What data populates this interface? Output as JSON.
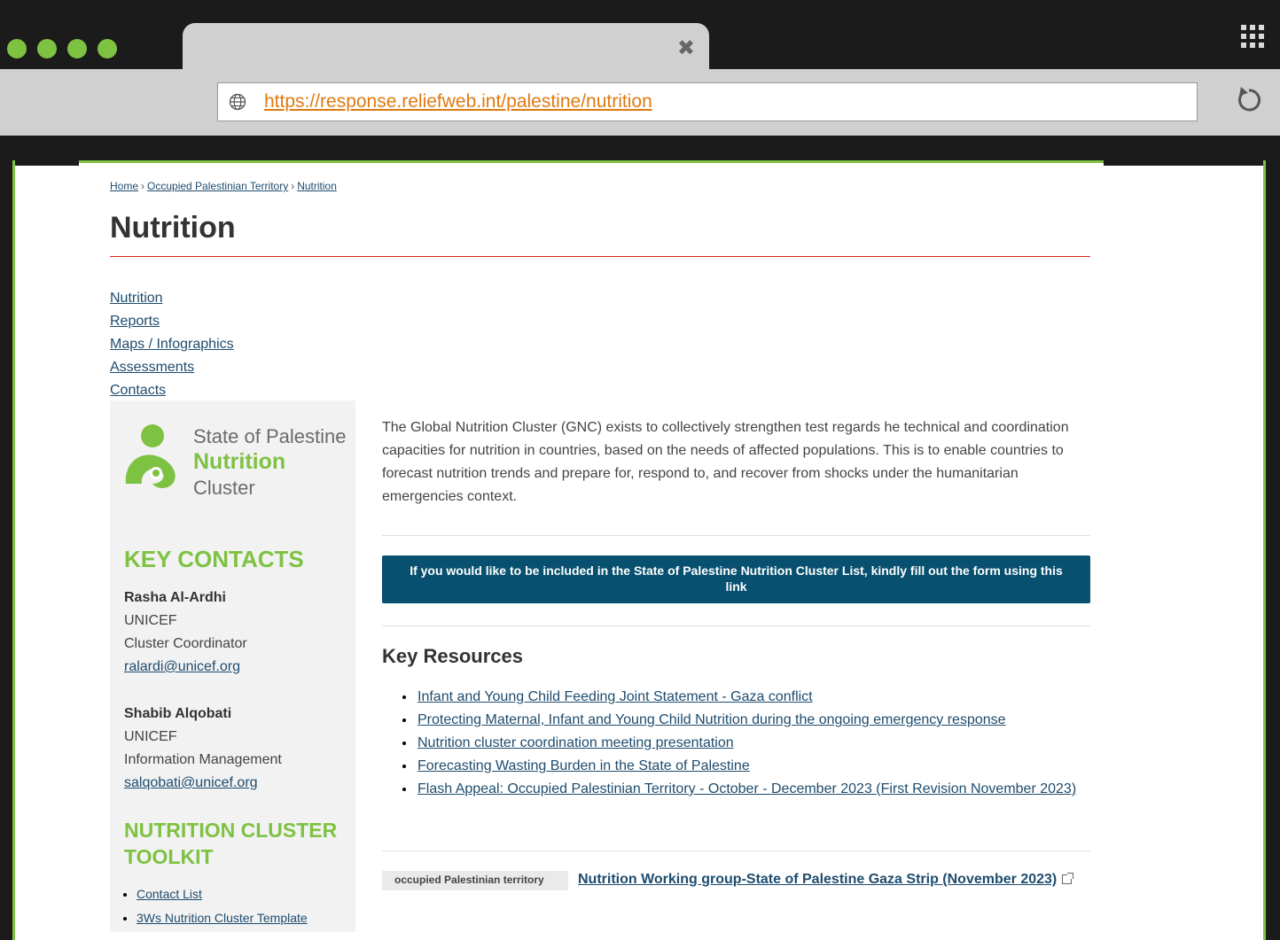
{
  "browser": {
    "tab_close": "✖",
    "url": "https://response.reliefweb.int/palestine/nutrition"
  },
  "breadcrumb": [
    "Home",
    "Occupied Palestinian Territory",
    "Nutrition"
  ],
  "breadcrumb_sep": "›",
  "page_title": "Nutrition",
  "subnav": [
    "Nutrition",
    "Reports",
    "Maps / Infographics",
    "Assessments",
    "Contacts"
  ],
  "logo": {
    "line1": "State of Palestine",
    "line2": "Nutrition",
    "line3": "Cluster"
  },
  "key_contacts": {
    "title": "KEY CONTACTS",
    "people": [
      {
        "name": "Rasha Al-Ardhi",
        "org": "UNICEF",
        "role": "Cluster Coordinator",
        "email": "ralardi@unicef.org"
      },
      {
        "name": "Shabib Alqobati",
        "org": "UNICEF",
        "role": "Information Management",
        "email": "salqobati@unicef.org"
      }
    ]
  },
  "toolkit": {
    "title": "NUTRITION CLUSTER TOOLKIT",
    "items": [
      "Contact List",
      "3Ws Nutrition Cluster Template"
    ]
  },
  "intro": "The Global Nutrition Cluster (GNC) exists to collectively strengthen test regards he technical and coordination capacities for nutrition in countries, based on the needs of affected populations. This is to enable countries to forecast nutrition trends and prepare for, respond to, and recover from shocks under the humanitarian emergencies context.",
  "banner": "If you would like to be included in the State of Palestine Nutrition Cluster List, kindly fill out the form using this link",
  "key_resources": {
    "title": "Key Resources",
    "items": [
      "Infant and Young Child Feeding Joint Statement - Gaza conflict",
      "Protecting Maternal, Infant and Young Child Nutrition during the ongoing emergency response",
      "Nutrition cluster coordination meeting presentation",
      "Forecasting Wasting Burden in the State of Palestine",
      "Flash Appeal: Occupied Palestinian Territory - October - December 2023 (First Revision November 2023)"
    ]
  },
  "report": {
    "tag": "occupied Palestinian territory",
    "title": "Nutrition Working group-State of Palestine Gaza Strip (November 2023)"
  },
  "colors": {
    "accent_green": "#7ec242",
    "banner_blue": "#07506f",
    "link": "#1e4c6e",
    "url_orange": "#e07a10"
  }
}
